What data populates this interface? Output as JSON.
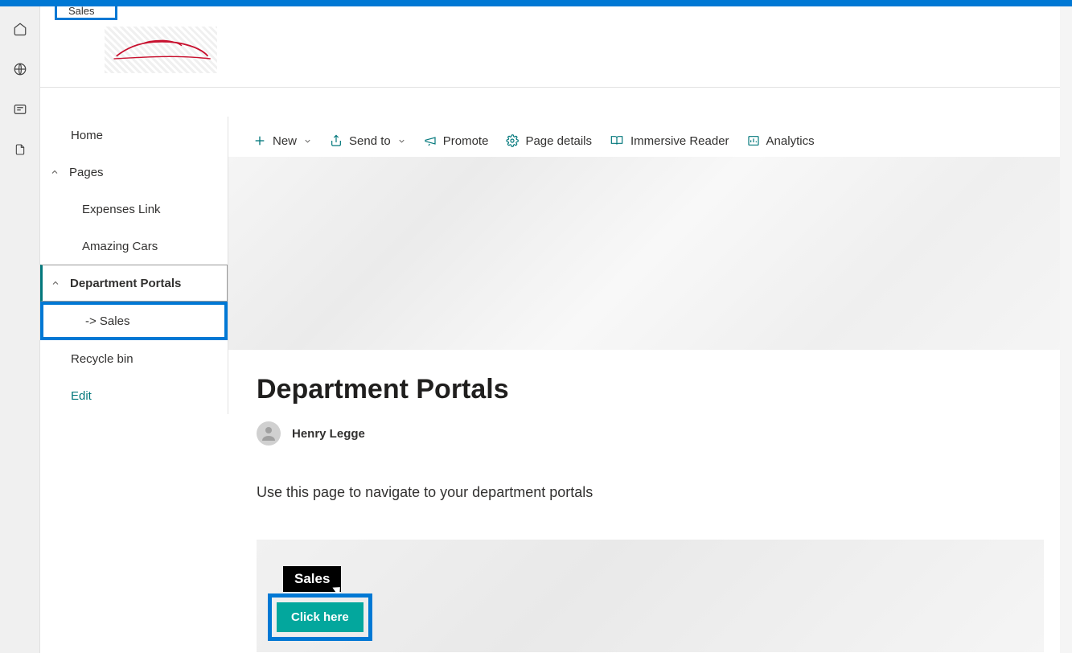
{
  "tab": {
    "label": "Sales"
  },
  "nav": {
    "home": "Home",
    "pages": "Pages",
    "expenses": "Expenses Link",
    "amazing": "Amazing Cars",
    "dept": "Department Portals",
    "sales": "-> Sales",
    "recycle": "Recycle bin",
    "edit": "Edit"
  },
  "cmd": {
    "new": "New",
    "sendto": "Send to",
    "promote": "Promote",
    "details": "Page details",
    "immersive": "Immersive Reader",
    "analytics": "Analytics"
  },
  "page": {
    "title": "Department Portals",
    "author": "Henry Legge",
    "desc": "Use this page to navigate to your department portals"
  },
  "card": {
    "tooltip": "Sales",
    "btn": "Click here"
  }
}
